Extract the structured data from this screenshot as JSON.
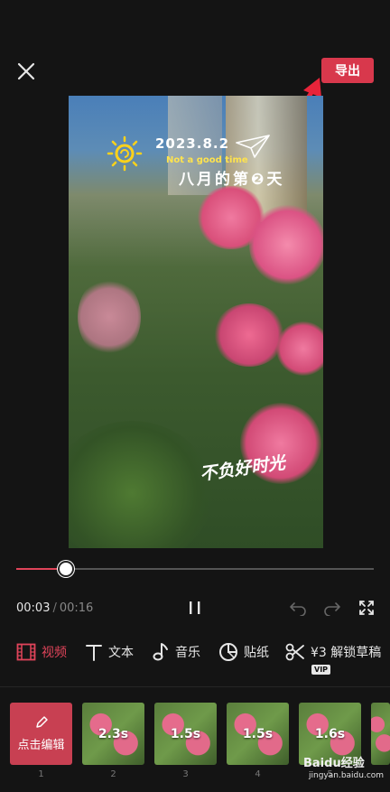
{
  "header": {
    "export_label": "导出"
  },
  "preview": {
    "date": "2023.8.2",
    "subtitle": "Not a good time",
    "title": "八月的第❷天",
    "bottom_text": "不负好时光"
  },
  "playback": {
    "current_time": "00:03",
    "separator": "/",
    "total_time": "00:16",
    "progress": 0.14
  },
  "toolbar": {
    "items": [
      {
        "label": "视频",
        "icon": "film-icon",
        "active": true
      },
      {
        "label": "文本",
        "icon": "text-icon",
        "active": false
      },
      {
        "label": "音乐",
        "icon": "music-note-icon",
        "active": false
      },
      {
        "label": "贴纸",
        "icon": "sticker-icon",
        "active": false
      },
      {
        "label": "¥3 解锁草稿",
        "icon": "scissors-icon",
        "active": false
      }
    ],
    "vip_badge": "VIP"
  },
  "clips": {
    "edit_label": "点击编辑",
    "items": [
      {
        "number": "1"
      },
      {
        "number": "2",
        "duration": "2.3s"
      },
      {
        "number": "3",
        "duration": "1.5s"
      },
      {
        "number": "4",
        "duration": "1.5s"
      },
      {
        "number": "5",
        "duration": "1.6s"
      }
    ]
  },
  "watermark": {
    "brand": "Baidu经验",
    "url": "jingyan.baidu.com"
  },
  "colors": {
    "accent": "#e0445a",
    "export_bg": "#d8384c",
    "background": "#141414"
  }
}
